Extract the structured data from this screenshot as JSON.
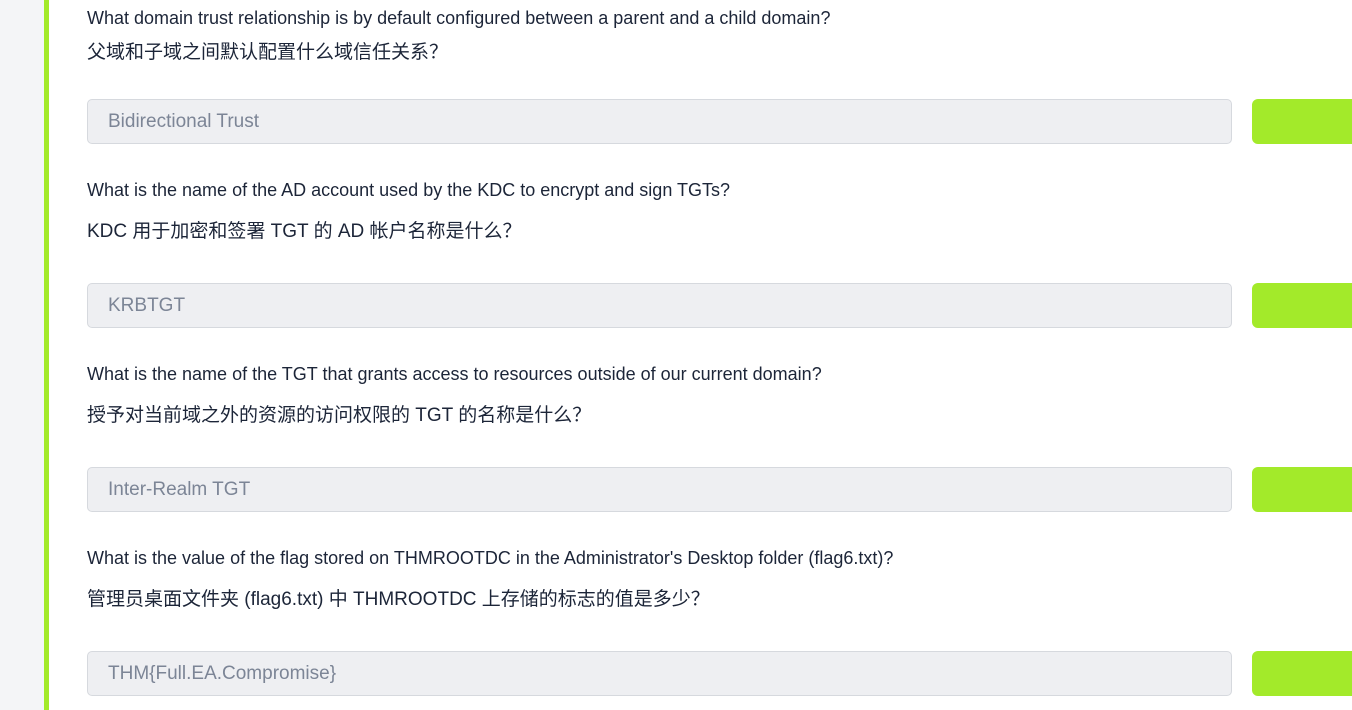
{
  "colors": {
    "accent": "#a3ea2a",
    "input_bg": "#eeeff2",
    "text": "#1c2538",
    "answer_text": "#7c8596"
  },
  "questions": [
    {
      "en": "What domain trust relationship is by default configured between a parent and a child domain?",
      "zh": "父域和子域之间默认配置什么域信任关系？",
      "answer": "Bidirectional Trust"
    },
    {
      "en": "What is the name of the AD account used by the KDC to encrypt and sign TGTs?",
      "zh": "KDC 用于加密和签署 TGT 的 AD 帐户名称是什么？",
      "answer": "KRBTGT"
    },
    {
      "en": "What is the name of the TGT that grants access to resources outside of our current domain?",
      "zh": "授予对当前域之外的资源的访问权限的 TGT 的名称是什么？",
      "answer": "Inter-Realm TGT"
    },
    {
      "en": "What is the value of the flag stored on THMROOTDC in the Administrator's Desktop folder (flag6.txt)?",
      "zh": "管理员桌面文件夹 (flag6.txt) 中 THMROOTDC 上存储的标志的值是多少？",
      "answer": "THM{Full.EA.Compromise}"
    }
  ]
}
